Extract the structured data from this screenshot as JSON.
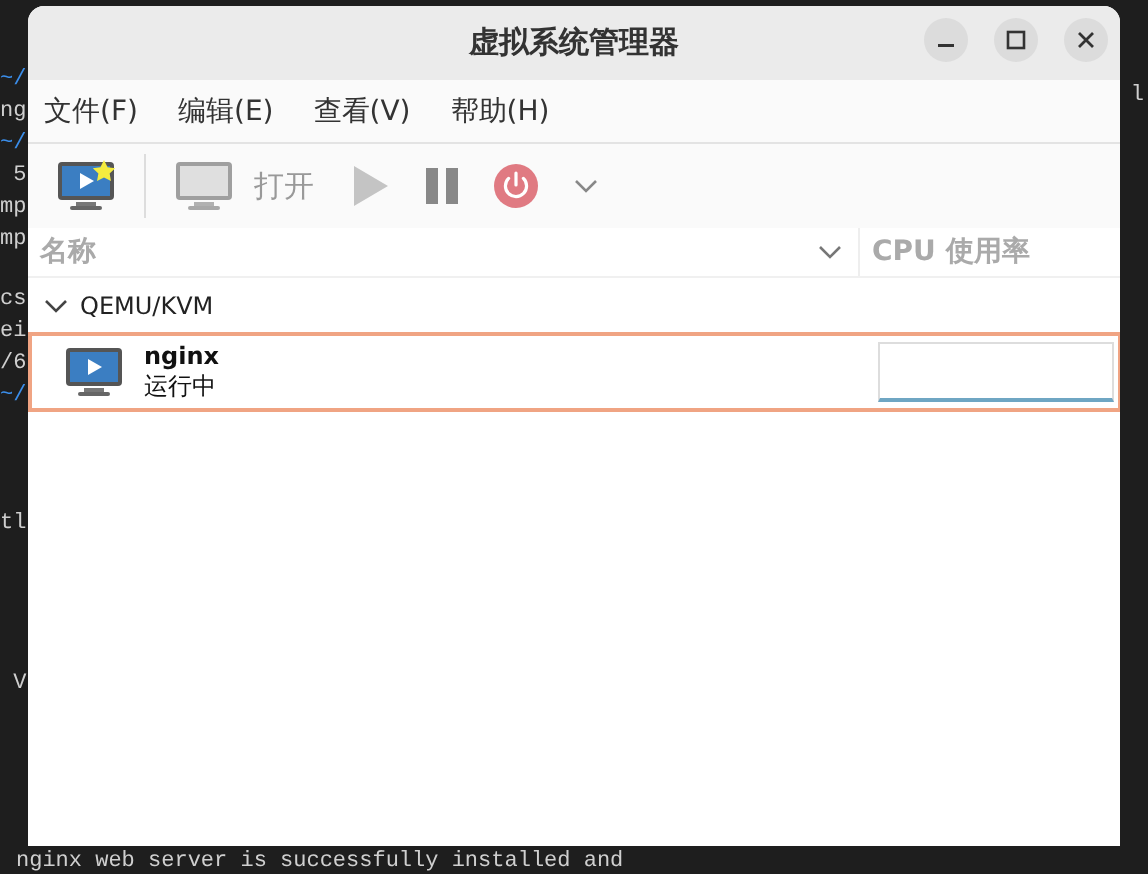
{
  "terminal": {
    "blocks": [
      {
        "lines": [
          {
            "text": "~/",
            "kind": "prompt"
          },
          {
            "text": "ng",
            "kind": "output"
          }
        ]
      },
      {
        "lines": [
          {
            "text": "~/",
            "kind": "prompt"
          },
          {
            "text": " 5",
            "kind": "output"
          },
          {
            "text": "mp",
            "kind": "output"
          },
          {
            "text": "mp",
            "kind": "output"
          }
        ]
      },
      {
        "lines": [
          {
            "text": "cs",
            "kind": "output"
          },
          {
            "text": "ei",
            "kind": "output"
          },
          {
            "text": "/6",
            "kind": "output"
          },
          {
            "text": "~/",
            "kind": "prompt"
          }
        ]
      },
      {
        "lines": [
          {
            "text": "tl",
            "kind": "output"
          }
        ]
      },
      {
        "lines": [
          {
            "text": " V",
            "kind": "output"
          }
        ]
      }
    ],
    "right_fragment": "l",
    "bottom_line": "nginx web server is successfully installed and"
  },
  "window": {
    "title": "虚拟系统管理器"
  },
  "menu": [
    {
      "label": "文件(F)"
    },
    {
      "label": "编辑(E)"
    },
    {
      "label": "查看(V)"
    },
    {
      "label": "帮助(H)"
    }
  ],
  "toolbar": [
    {
      "kind": "new-vm",
      "disabled": false
    },
    {
      "kind": "separator"
    },
    {
      "kind": "open",
      "label": "打开",
      "disabled": true
    },
    {
      "kind": "run",
      "disabled": true
    },
    {
      "kind": "pause",
      "disabled": false
    },
    {
      "kind": "shutdown",
      "disabled": false
    },
    {
      "kind": "dropdown",
      "disabled": false
    }
  ],
  "table": {
    "columns": [
      "名称",
      "CPU 使用率"
    ],
    "groups": [
      {
        "name": "QEMU/KVM",
        "expanded": true,
        "children": [
          {
            "name": "nginx",
            "status": "运行中",
            "selected": true,
            "running": true
          }
        ]
      }
    ]
  }
}
